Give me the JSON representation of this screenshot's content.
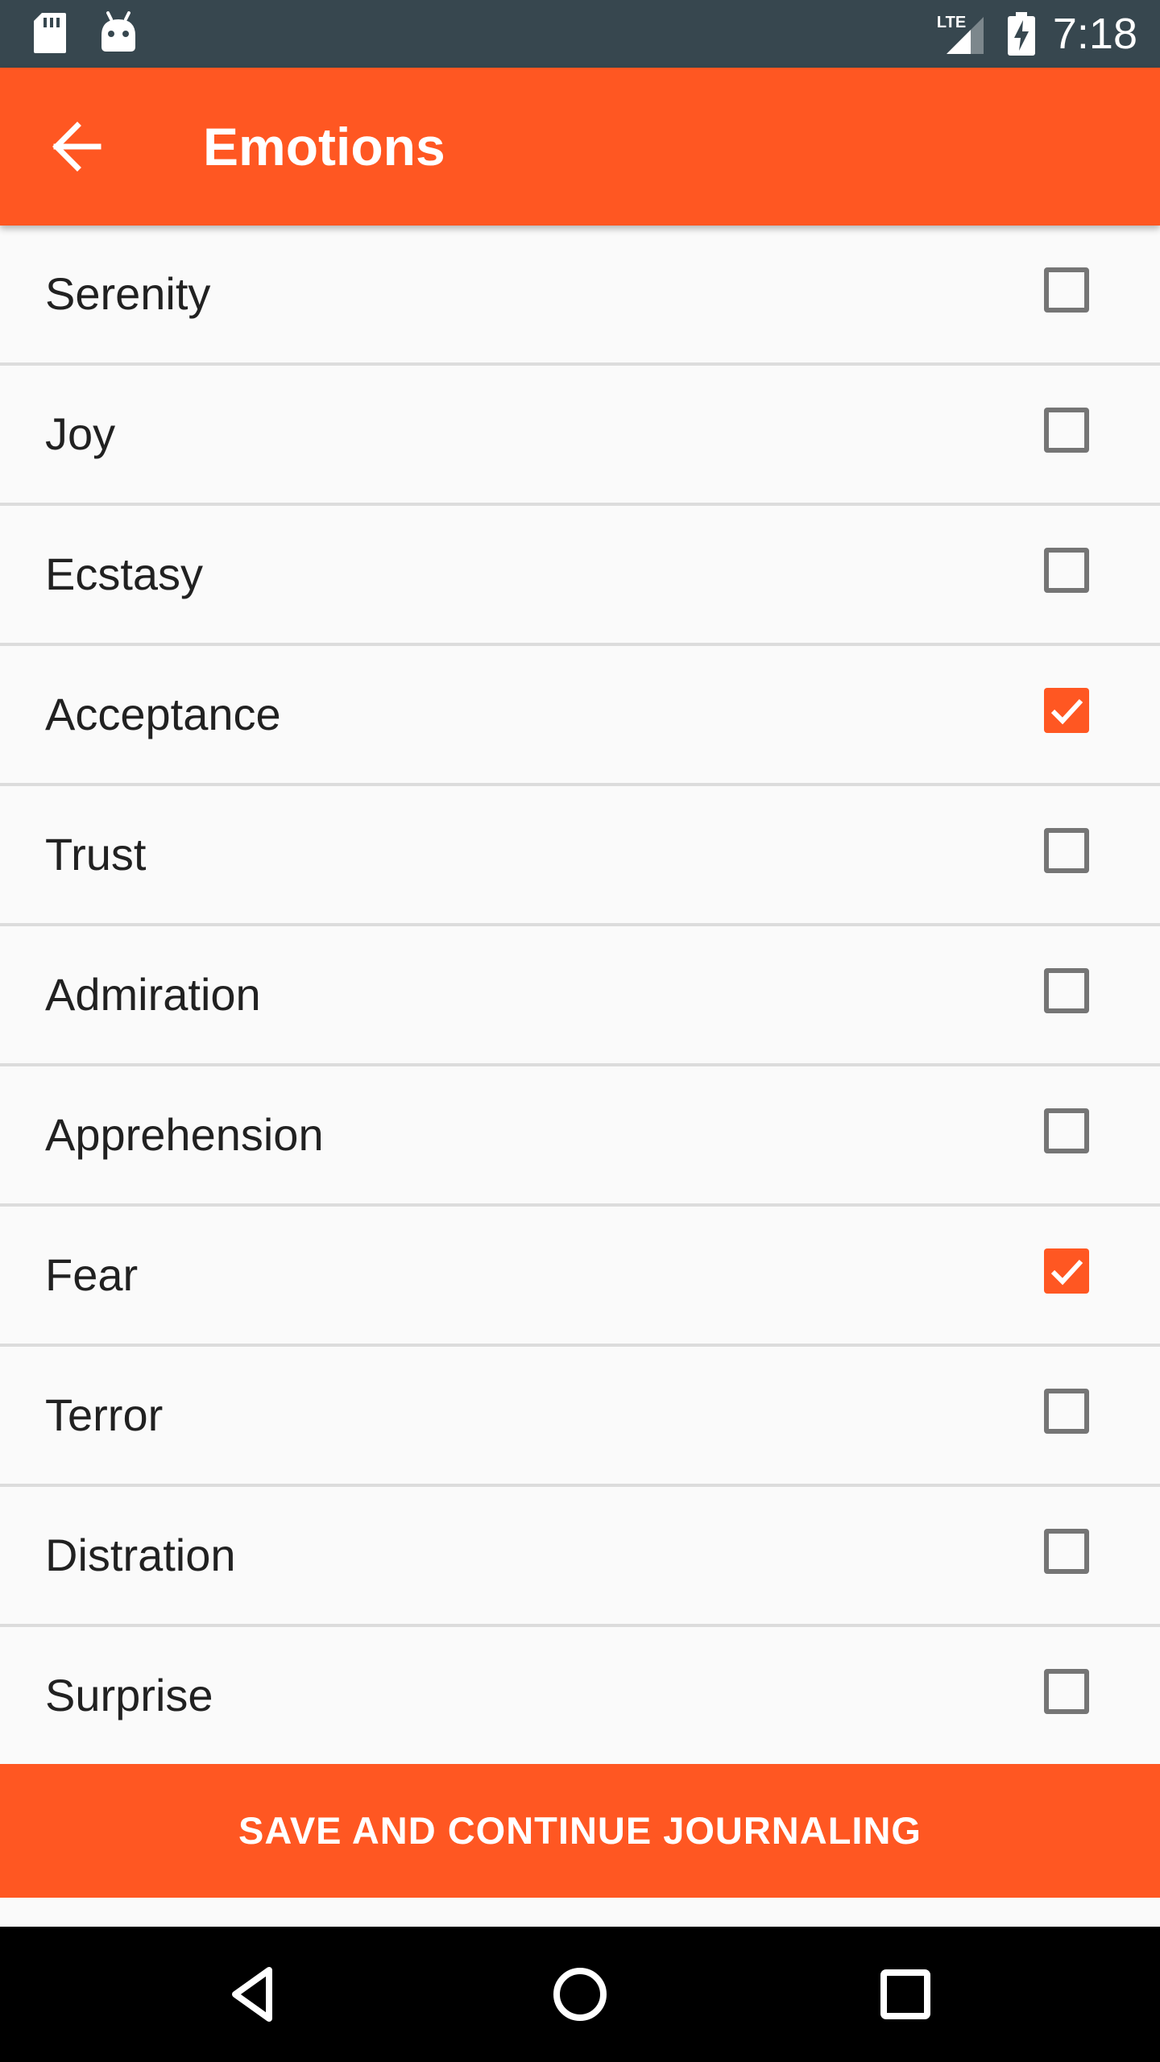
{
  "status_bar": {
    "time": "7:18",
    "network_label": "LTE",
    "left_icons": [
      "sd-card-icon",
      "android-icon"
    ],
    "right_icons": [
      "signal-icon",
      "battery-charging-icon"
    ]
  },
  "app_bar": {
    "title": "Emotions",
    "back_icon": "arrow-back-icon",
    "color": "#ff5722"
  },
  "emotions": [
    {
      "label": "Serenity",
      "checked": false
    },
    {
      "label": "Joy",
      "checked": false
    },
    {
      "label": "Ecstasy",
      "checked": false
    },
    {
      "label": "Acceptance",
      "checked": true
    },
    {
      "label": "Trust",
      "checked": false
    },
    {
      "label": "Admiration",
      "checked": false
    },
    {
      "label": "Apprehension",
      "checked": false
    },
    {
      "label": "Fear",
      "checked": true
    },
    {
      "label": "Terror",
      "checked": false
    },
    {
      "label": "Distration",
      "checked": false
    },
    {
      "label": "Surprise",
      "checked": false
    }
  ],
  "save_button": {
    "label": "SAVE AND CONTINUE JOURNALING"
  },
  "nav_bar": {
    "icons": [
      "back-triangle-icon",
      "home-circle-icon",
      "recents-square-icon"
    ]
  },
  "colors": {
    "accent": "#ff5722",
    "status_bar": "#37474f",
    "background": "#fafafa"
  }
}
